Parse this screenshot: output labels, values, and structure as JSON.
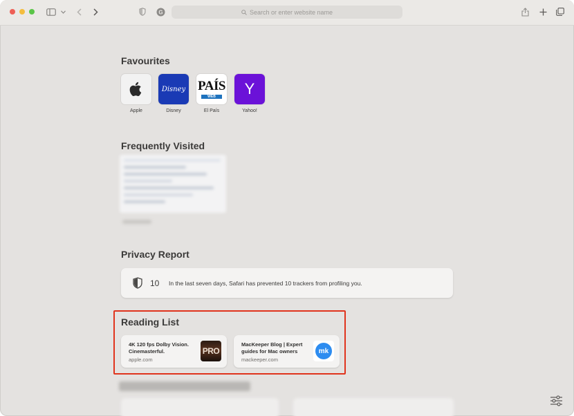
{
  "toolbar": {
    "url_placeholder": "Search or enter website name"
  },
  "favourites": {
    "title": "Favourites",
    "items": [
      {
        "label": "Apple",
        "icon": "apple-logo-icon",
        "bg": "#f2f2f2"
      },
      {
        "label": "Disney",
        "icon": "disney-logo-icon",
        "bg": "#1a3ab5",
        "logo_text": "Disney"
      },
      {
        "label": "El País",
        "icon": "el-pais-logo-icon",
        "bg": "#ffffff",
        "logo_text": "PAÍS",
        "badge_text": "WEB"
      },
      {
        "label": "Yahoo!",
        "icon": "yahoo-logo-icon",
        "bg": "#6b12d8",
        "logo_text": "Y"
      }
    ]
  },
  "frequently_visited": {
    "title": "Frequently Visited"
  },
  "privacy_report": {
    "title": "Privacy Report",
    "count": "10",
    "text": "In the last seven days, Safari has prevented 10 trackers from profiling you."
  },
  "reading_list": {
    "title": "Reading List",
    "items": [
      {
        "title": "4K 120 fps Dolby Vision. Cinemasterful.",
        "domain": "apple.com",
        "thumb_text": "PRO"
      },
      {
        "title": "MacKeeper Blog | Expert guides for Mac owners",
        "domain": "mackeeper.com",
        "thumb_text": "mk"
      }
    ]
  },
  "colors": {
    "highlight": "#e0331c",
    "window_bg": "#e4e2e0"
  }
}
